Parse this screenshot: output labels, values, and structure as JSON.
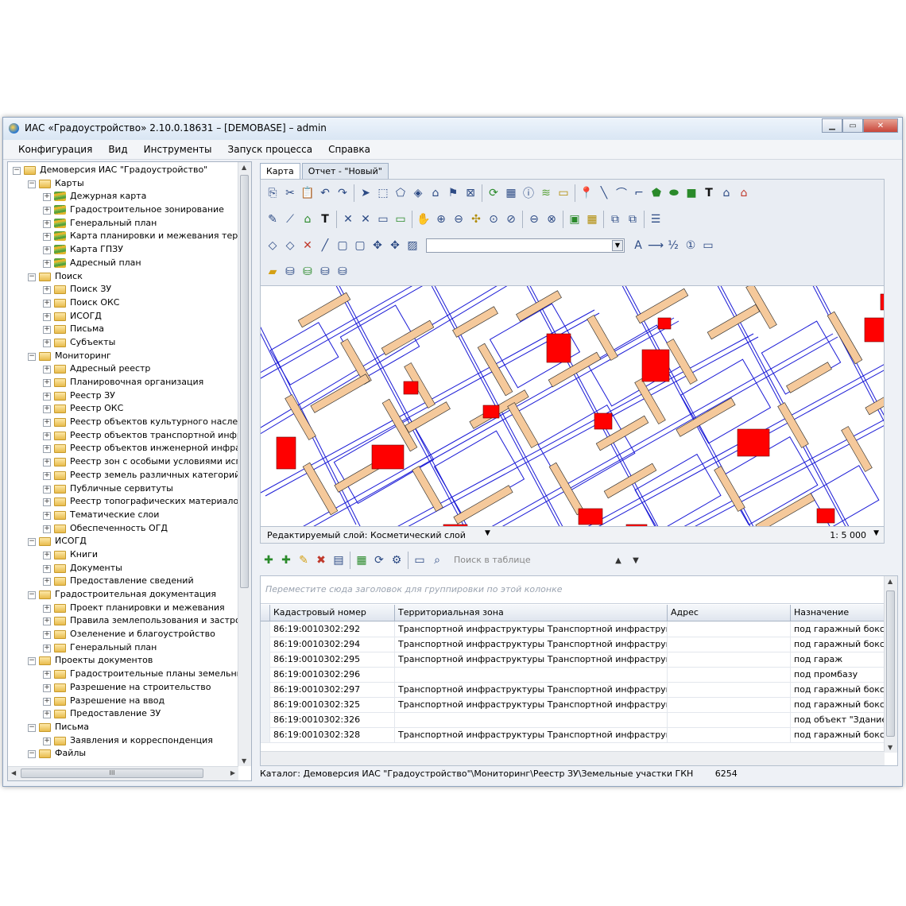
{
  "window": {
    "title": "ИАС «Градоустройство» 2.10.0.18631 – [DEMOBASE] – admin",
    "btn_min": "▁",
    "btn_max": "▭",
    "btn_close": "✕"
  },
  "menu": [
    "Конфигурация",
    "Вид",
    "Инструменты",
    "Запуск процесса",
    "Справка"
  ],
  "tree": [
    {
      "level": 0,
      "label": "Демоверсия ИАС \"Градоустройство\"",
      "icon": "folder-icon",
      "ex": "−"
    },
    {
      "level": 1,
      "label": "Карты",
      "icon": "folder-icon",
      "ex": "−"
    },
    {
      "level": 2,
      "label": "Дежурная карта",
      "icon": "layers-icon",
      "ex": "+"
    },
    {
      "level": 2,
      "label": "Градостроительное зонирование",
      "icon": "layers-icon",
      "ex": "+"
    },
    {
      "level": 2,
      "label": "Генеральный план",
      "icon": "layers-icon",
      "ex": "+"
    },
    {
      "level": 2,
      "label": "Карта планировки и межевания террит",
      "icon": "layers-icon",
      "ex": "+"
    },
    {
      "level": 2,
      "label": "Карта ГПЗУ",
      "icon": "layers-icon",
      "ex": "+"
    },
    {
      "level": 2,
      "label": "Адресный план",
      "icon": "layers-icon",
      "ex": "+"
    },
    {
      "level": 1,
      "label": "Поиск",
      "icon": "folder-icon",
      "ex": "−"
    },
    {
      "level": 2,
      "label": "Поиск ЗУ",
      "icon": "folder-icon",
      "ex": "+"
    },
    {
      "level": 2,
      "label": "Поиск ОКС",
      "icon": "folder-icon",
      "ex": "+"
    },
    {
      "level": 2,
      "label": "ИСОГД",
      "icon": "folder-icon",
      "ex": "+"
    },
    {
      "level": 2,
      "label": "Письма",
      "icon": "folder-icon",
      "ex": "+"
    },
    {
      "level": 2,
      "label": "Субъекты",
      "icon": "folder-icon",
      "ex": "+"
    },
    {
      "level": 1,
      "label": "Мониторинг",
      "icon": "folder-icon",
      "ex": "−"
    },
    {
      "level": 2,
      "label": "Адресный реестр",
      "icon": "folder-icon",
      "ex": "+"
    },
    {
      "level": 2,
      "label": "Планировочная организация",
      "icon": "folder-icon",
      "ex": "+"
    },
    {
      "level": 2,
      "label": "Реестр ЗУ",
      "icon": "folder-icon",
      "ex": "+"
    },
    {
      "level": 2,
      "label": "Реестр ОКС",
      "icon": "folder-icon",
      "ex": "+"
    },
    {
      "level": 2,
      "label": "Реестр объектов культурного наследи",
      "icon": "folder-icon",
      "ex": "+"
    },
    {
      "level": 2,
      "label": "Реестр объектов транспортной инфра",
      "icon": "folder-icon",
      "ex": "+"
    },
    {
      "level": 2,
      "label": "Реестр объектов инженерной инфраст",
      "icon": "folder-icon",
      "ex": "+"
    },
    {
      "level": 2,
      "label": "Реестр зон с особыми условиями испо",
      "icon": "folder-icon",
      "ex": "+"
    },
    {
      "level": 2,
      "label": "Реестр земель различных категорий",
      "icon": "folder-icon",
      "ex": "+"
    },
    {
      "level": 2,
      "label": "Публичные сервитуты",
      "icon": "folder-icon",
      "ex": "+"
    },
    {
      "level": 2,
      "label": "Реестр топографических материалов",
      "icon": "folder-icon",
      "ex": "+"
    },
    {
      "level": 2,
      "label": "Тематические слои",
      "icon": "folder-icon",
      "ex": "+"
    },
    {
      "level": 2,
      "label": "Обеспеченность ОГД",
      "icon": "folder-icon",
      "ex": "+"
    },
    {
      "level": 1,
      "label": "ИСОГД",
      "icon": "folder-icon",
      "ex": "−"
    },
    {
      "level": 2,
      "label": "Книги",
      "icon": "folder-icon",
      "ex": "+"
    },
    {
      "level": 2,
      "label": "Документы",
      "icon": "folder-icon",
      "ex": "+"
    },
    {
      "level": 2,
      "label": "Предоставление сведений",
      "icon": "folder-icon",
      "ex": "+"
    },
    {
      "level": 1,
      "label": "Градостроительная документация",
      "icon": "folder-icon",
      "ex": "−"
    },
    {
      "level": 2,
      "label": "Проект планировки и межевания",
      "icon": "folder-icon",
      "ex": "+"
    },
    {
      "level": 2,
      "label": "Правила землепользования и застрой",
      "icon": "folder-icon",
      "ex": "+"
    },
    {
      "level": 2,
      "label": "Озеленение и благоустройство",
      "icon": "folder-icon",
      "ex": "+"
    },
    {
      "level": 2,
      "label": "Генеральный план",
      "icon": "folder-icon",
      "ex": "+"
    },
    {
      "level": 1,
      "label": "Проекты документов",
      "icon": "folder-icon",
      "ex": "−"
    },
    {
      "level": 2,
      "label": "Градостроительные планы земельных",
      "icon": "folder-icon",
      "ex": "+"
    },
    {
      "level": 2,
      "label": "Разрешение на строительство",
      "icon": "folder-icon",
      "ex": "+"
    },
    {
      "level": 2,
      "label": "Разрешение на ввод",
      "icon": "folder-icon",
      "ex": "+"
    },
    {
      "level": 2,
      "label": "Предоставление ЗУ",
      "icon": "folder-icon",
      "ex": "+"
    },
    {
      "level": 1,
      "label": "Письма",
      "icon": "folder-icon",
      "ex": "−"
    },
    {
      "level": 2,
      "label": "Заявления и корреспонденция",
      "icon": "folder-icon",
      "ex": "+"
    },
    {
      "level": 1,
      "label": "Файлы",
      "icon": "folder-icon",
      "ex": "−"
    }
  ],
  "tree_scroll_grip": "III",
  "tabs": [
    {
      "label": "Карта",
      "active": true
    },
    {
      "label": "Отчет - \"Новый\"",
      "active": false
    }
  ],
  "map": {
    "layer_label": "Редактируемый слой: Косметический слой",
    "scale": "1: 5 000",
    "building_color": "#f5c99b",
    "highlight_color": "#ff0000",
    "line_color": "#1a1ad6"
  },
  "grid": {
    "search_placeholder": "Поиск в таблице",
    "group_hint": "Переместите сюда заголовок для группировки по этой колонке",
    "columns": [
      "Кадастровый номер",
      "Территориальная зона",
      "Адрес",
      "Назначение"
    ],
    "rows": [
      [
        "86:19:0010302:292",
        "Транспортной инфраструктуры Транспортной инфраструкту...",
        "",
        "под гаражный бокс №"
      ],
      [
        "86:19:0010302:294",
        "Транспортной инфраструктуры Транспортной инфраструкту...",
        "",
        "под гаражный бокс №"
      ],
      [
        "86:19:0010302:295",
        "Транспортной инфраструктуры Транспортной инфраструкту...",
        "",
        "под гараж"
      ],
      [
        "86:19:0010302:296",
        "",
        "",
        "под промбазу"
      ],
      [
        "86:19:0010302:297",
        "Транспортной инфраструктуры Транспортной инфраструкту...",
        "",
        "под гаражный бокс №"
      ],
      [
        "86:19:0010302:325",
        "Транспортной инфраструктуры Транспортной инфраструкту...",
        "",
        "под гаражный бокс №"
      ],
      [
        "86:19:0010302:326",
        "",
        "",
        "под объект \"Здание"
      ],
      [
        "86:19:0010302:328",
        "Транспортной инфраструктуры Транспортной инфраструкту...",
        "",
        "под гаражный бокс №"
      ]
    ]
  },
  "status": {
    "catalog": "Каталог: Демоверсия ИАС \"Градоустройство\"\\Мониторинг\\Реестр ЗУ\\Земельные участки ГКН",
    "count": "6254"
  }
}
